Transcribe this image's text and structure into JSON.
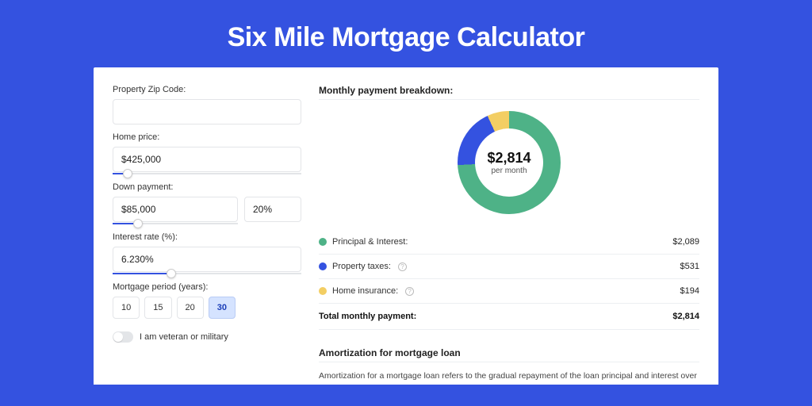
{
  "page": {
    "title": "Six Mile Mortgage Calculator"
  },
  "form": {
    "zip_label": "Property Zip Code:",
    "zip_value": "",
    "home_price_label": "Home price:",
    "home_price_value": "$425,000",
    "home_price_slider_pct": 8,
    "down_payment_label": "Down payment:",
    "down_payment_value": "$85,000",
    "down_payment_pct": "20%",
    "down_payment_slider_pct": 20,
    "interest_label": "Interest rate (%):",
    "interest_value": "6.230%",
    "interest_slider_pct": 31,
    "period_label": "Mortgage period (years):",
    "periods": [
      "10",
      "15",
      "20",
      "30"
    ],
    "period_selected_index": 3,
    "veteran_label": "I am veteran or military"
  },
  "breakdown": {
    "header": "Monthly payment breakdown:",
    "donut_amount": "$2,814",
    "donut_sub": "per month",
    "items": [
      {
        "label": "Principal & Interest:",
        "value": "$2,089",
        "color": "#4eb287",
        "info": false
      },
      {
        "label": "Property taxes:",
        "value": "$531",
        "color": "#3452e0",
        "info": true
      },
      {
        "label": "Home insurance:",
        "value": "$194",
        "color": "#f3ce63",
        "info": true
      }
    ],
    "total_label": "Total monthly payment:",
    "total_value": "$2,814"
  },
  "chart_data": {
    "type": "pie",
    "title": "Monthly payment breakdown",
    "series": [
      {
        "name": "Principal & Interest",
        "value": 2089,
        "color": "#4eb287"
      },
      {
        "name": "Property taxes",
        "value": 531,
        "color": "#3452e0"
      },
      {
        "name": "Home insurance",
        "value": 194,
        "color": "#f3ce63"
      }
    ],
    "total": 2814,
    "unit": "USD per month"
  },
  "amortization": {
    "header": "Amortization for mortgage loan",
    "text": "Amortization for a mortgage loan refers to the gradual repayment of the loan principal and interest over a specified"
  }
}
